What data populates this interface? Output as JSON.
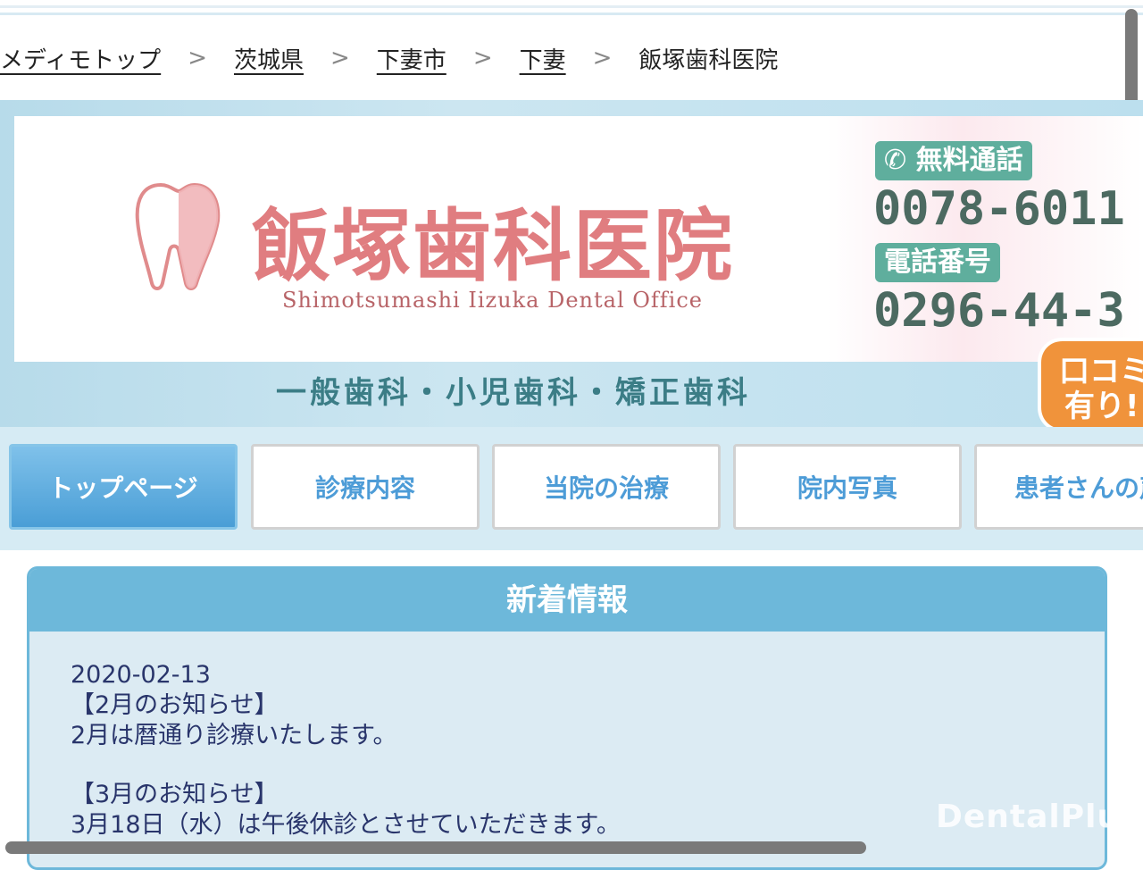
{
  "breadcrumb": {
    "items": [
      "メディモトップ",
      "茨城県",
      "下妻市",
      "下妻"
    ],
    "separator": ">",
    "current": "飯塚歯科医院"
  },
  "header": {
    "clinic_name": "飯塚歯科医院",
    "clinic_subtitle": "Shimotsumashi Iizuka Dental Office",
    "free_call_label": "無料通話",
    "free_call_number": "0078-6011",
    "tel_label": "電話番号",
    "tel_number": "0296-44-3",
    "tagline": "一般歯科・小児歯科・矯正歯科",
    "badge_text": "口コミ有り!"
  },
  "nav": {
    "items": [
      "トップページ",
      "診療内容",
      "当院の治療",
      "院内写真",
      "患者さんの声"
    ],
    "active_index": 0
  },
  "news": {
    "title": "新着情報",
    "date": "2020-02-13",
    "line1": "【2月のお知らせ】",
    "line2": "2月は暦通り診療いたします。",
    "line3": "【3月のお知らせ】",
    "line4": "3月18日（水）は午後休診とさせていただきます。"
  },
  "watermark": "DentalPlus",
  "colors": {
    "accent_blue": "#6db8da",
    "clinic_pink": "#e07d80",
    "nav_text": "#4d9cd7",
    "phone_green": "#5fae9d"
  }
}
